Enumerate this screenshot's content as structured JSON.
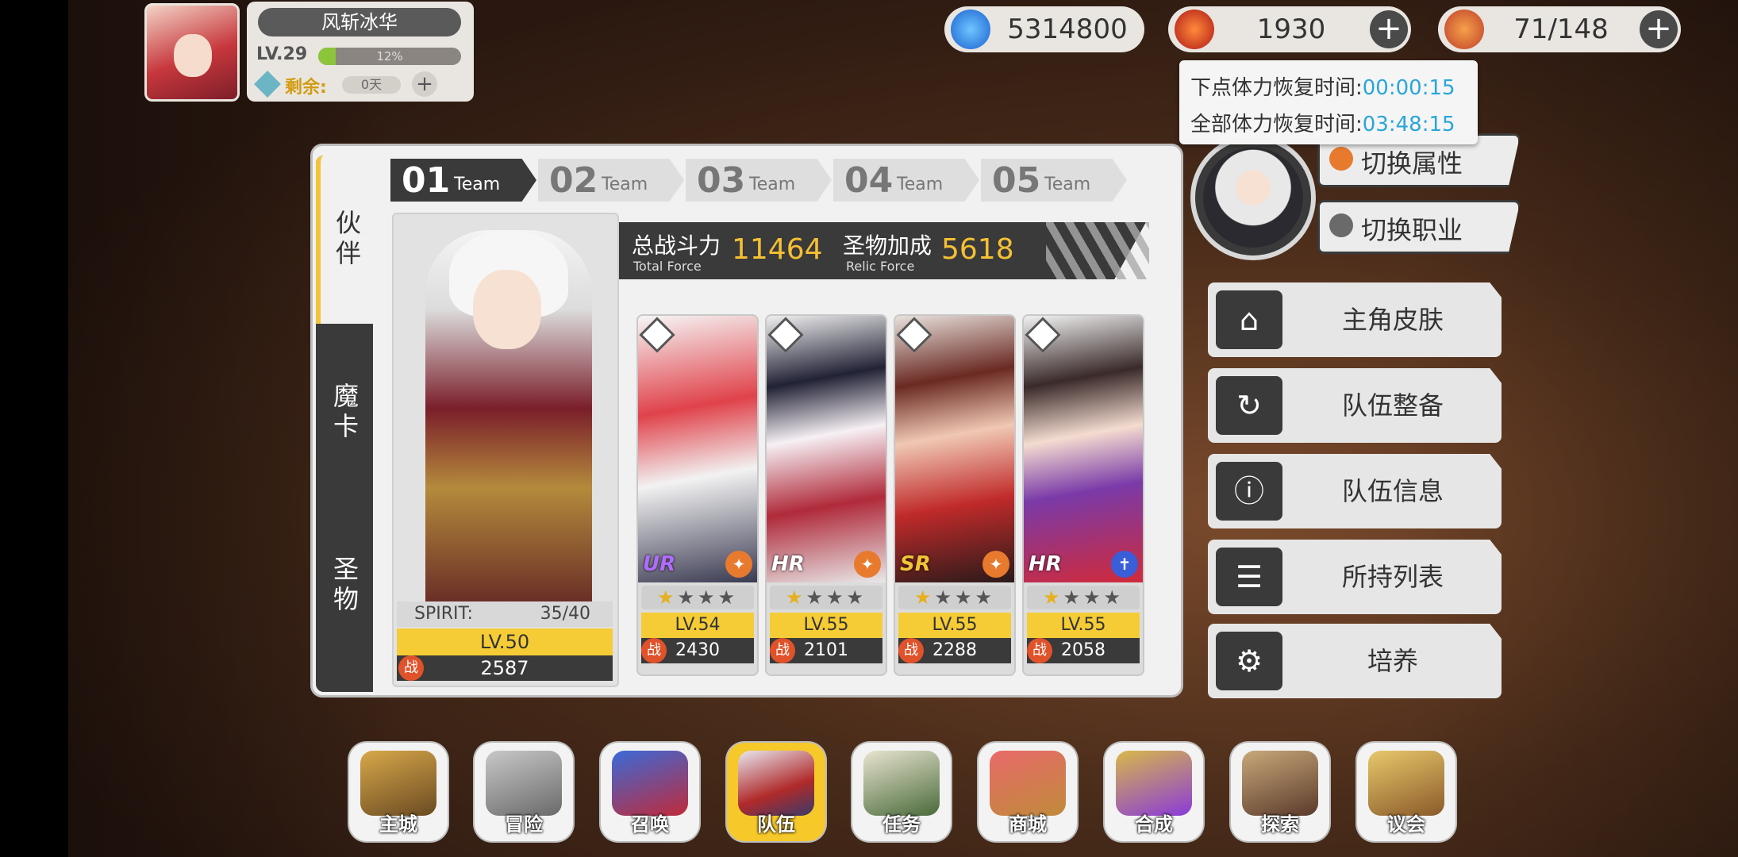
{
  "profile": {
    "name": "风斩冰华",
    "level": "LV.29",
    "xp_percent": "12%",
    "xp_fraction": 0.12,
    "remaining_label": "剩余:",
    "remaining_value": "0天",
    "plus": "+"
  },
  "resources": [
    {
      "name": "crystal",
      "icon": "blue-flame-icon",
      "value": "5314800"
    },
    {
      "name": "gems",
      "icon": "red-gem-icon",
      "value": "1930",
      "plus": "+"
    },
    {
      "name": "stamina",
      "icon": "hotdog-icon",
      "value": "71/148",
      "plus": "+"
    }
  ],
  "tooltip": {
    "next_label": "下点体力恢复时间:",
    "next_time": "00:00:15",
    "all_label": "全部体力恢复时间:",
    "all_time": "03:48:15"
  },
  "side_tabs": [
    "伙伴",
    "魔卡",
    "圣物"
  ],
  "teams": [
    {
      "num": "01",
      "label": "Team"
    },
    {
      "num": "02",
      "label": "Team"
    },
    {
      "num": "03",
      "label": "Team"
    },
    {
      "num": "04",
      "label": "Team"
    },
    {
      "num": "05",
      "label": "Team"
    }
  ],
  "force": {
    "total_label": "总战斗力",
    "total_sub": "Total Force",
    "total_value": "11464",
    "relic_label": "圣物加成",
    "relic_sub": "Relic Force",
    "relic_value": "5618"
  },
  "leader": {
    "spirit_label": "SPIRIT:",
    "spirit_value": "35/40",
    "level": "LV.50",
    "power": "2587",
    "zhan": "战"
  },
  "cards": [
    {
      "rarity": "UR",
      "stars": "★★★★",
      "gold": 1,
      "level": "LV.54",
      "power": "2430",
      "attr_color": "#e87a2e"
    },
    {
      "rarity": "HR",
      "stars": "★★★★",
      "gold": 1,
      "level": "LV.55",
      "power": "2101",
      "attr_color": "#e87a2e"
    },
    {
      "rarity": "SR",
      "stars": "★★★★",
      "gold": 1,
      "level": "LV.55",
      "power": "2288",
      "attr_color": "#e87a2e"
    },
    {
      "rarity": "HR",
      "stars": "★★★★",
      "gold": 1,
      "level": "LV.55",
      "power": "2058",
      "attr_color": "#3a5ed8"
    }
  ],
  "switch_buttons": [
    "切换属性",
    "切换职业"
  ],
  "menu": [
    {
      "label": "主角皮肤",
      "icon": "hanger-icon"
    },
    {
      "label": "队伍整备",
      "icon": "refresh-icon"
    },
    {
      "label": "队伍信息",
      "icon": "group-info-icon"
    },
    {
      "label": "所持列表",
      "icon": "list-icon"
    },
    {
      "label": "培养",
      "icon": "triad-icon"
    }
  ],
  "nav": [
    {
      "label": "主城"
    },
    {
      "label": "冒险"
    },
    {
      "label": "召唤"
    },
    {
      "label": "队伍"
    },
    {
      "label": "任务"
    },
    {
      "label": "商城"
    },
    {
      "label": "合成"
    },
    {
      "label": "探索"
    },
    {
      "label": "议会"
    }
  ]
}
